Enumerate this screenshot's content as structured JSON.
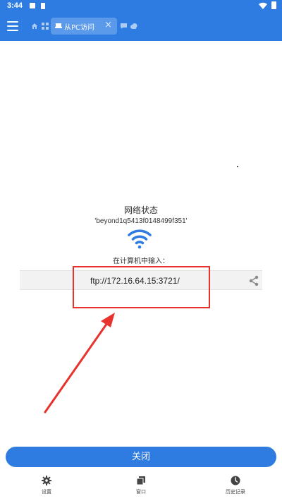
{
  "status_bar": {
    "time": "3:44"
  },
  "toolbar": {
    "active_tab_label": "从PC访问",
    "tab_close": "×"
  },
  "main": {
    "network_title": "网络状态",
    "ssid": "'beyond1q5413f0148499f351'",
    "instruction": "在计算机中输入：",
    "ftp_address": "ftp://172.16.64.15:3721/"
  },
  "actions": {
    "close_label": "关闭"
  },
  "bottom_nav": {
    "items": [
      {
        "label": "设置",
        "icon": "gear-icon"
      },
      {
        "label": "窗口",
        "icon": "windows-icon"
      },
      {
        "label": "历史记录",
        "icon": "clock-icon"
      }
    ]
  },
  "colors": {
    "primary": "#2e7be2",
    "annotation": "#e8322e"
  }
}
